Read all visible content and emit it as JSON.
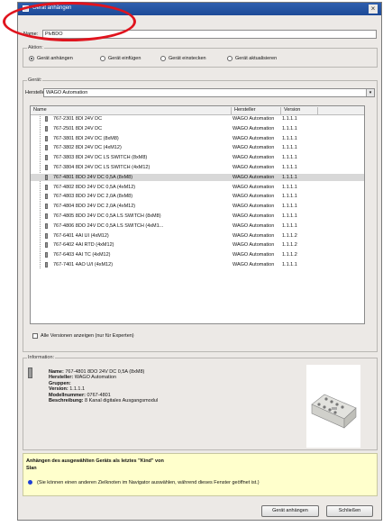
{
  "dialog": {
    "title": "Gerät anhängen",
    "close_glyph": "×"
  },
  "name": {
    "label": "Name:",
    "value": "PlvBDO"
  },
  "aktion": {
    "group_title": "Aktion:",
    "options": [
      {
        "label": "Gerät anhängen",
        "selected": true
      },
      {
        "label": "Gerät einfügen",
        "selected": false
      },
      {
        "label": "Gerät einstecken",
        "selected": false
      },
      {
        "label": "Gerät aktualisieren",
        "selected": false
      }
    ]
  },
  "geraet": {
    "group_title": "Gerät:",
    "hersteller_label": "Hersteller:",
    "hersteller_value": "WAGO Automation",
    "dropdown_glyph": "▾",
    "columns": {
      "name": "Name",
      "hersteller": "Hersteller",
      "version": "Version"
    },
    "rows": [
      {
        "name": "767-2301 8DI 24V DC",
        "hersteller": "WAGO Automation",
        "version": "1.1.1.1",
        "selected": false
      },
      {
        "name": "767-2501 8DI 24V DC",
        "hersteller": "WAGO Automation",
        "version": "1.1.1.1",
        "selected": false
      },
      {
        "name": "767-3801 8DI 24V DC (8xM8)",
        "hersteller": "WAGO Automation",
        "version": "1.1.1.1",
        "selected": false
      },
      {
        "name": "767-3802 8DI 24V DC (4xM12)",
        "hersteller": "WAGO Automation",
        "version": "1.1.1.1",
        "selected": false
      },
      {
        "name": "767-3803 8DI 24V DC LS SWITCH (8xM8)",
        "hersteller": "WAGO Automation",
        "version": "1.1.1.1",
        "selected": false
      },
      {
        "name": "767-3804 8DI 24V DC LS SWITCH (4xM12)",
        "hersteller": "WAGO Automation",
        "version": "1.1.1.1",
        "selected": false
      },
      {
        "name": "767-4801 8DO 24V DC 0,5A (8xM8)",
        "hersteller": "WAGO Automation",
        "version": "1.1.1.1",
        "selected": true
      },
      {
        "name": "767-4802 8DO 24V DC 0,5A (4xM12)",
        "hersteller": "WAGO Automation",
        "version": "1.1.1.1",
        "selected": false
      },
      {
        "name": "767-4803 8DO 24V DC 2,0A (8xM8)",
        "hersteller": "WAGO Automation",
        "version": "1.1.1.1",
        "selected": false
      },
      {
        "name": "767-4804 8DO 24V DC 2,0A (4xM12)",
        "hersteller": "WAGO Automation",
        "version": "1.1.1.1",
        "selected": false
      },
      {
        "name": "767-4805 8DO 24V DC 0,5A LS SWITCH (8xM8)",
        "hersteller": "WAGO Automation",
        "version": "1.1.1.1",
        "selected": false
      },
      {
        "name": "767-4806 8DO 24V DC 0,5A LS SWITCH (4xM1...",
        "hersteller": "WAGO Automation",
        "version": "1.1.1.1",
        "selected": false
      },
      {
        "name": "767-6401 4AI UI (4xM12)",
        "hersteller": "WAGO Automation",
        "version": "1.1.1.2",
        "selected": false
      },
      {
        "name": "767-6402 4AI RTD (4xM12)",
        "hersteller": "WAGO Automation",
        "version": "1.1.1.2",
        "selected": false
      },
      {
        "name": "767-6403 4AI TC (4xM12)",
        "hersteller": "WAGO Automation",
        "version": "1.1.1.2",
        "selected": false
      },
      {
        "name": "767-7401 4AO U/I (4xM12)",
        "hersteller": "WAGO Automation",
        "version": "1.1.1.1",
        "selected": false
      }
    ],
    "all_versions_label": "Alle Versionen anzeigen (nur für Experten)"
  },
  "information": {
    "group_title": "Information:",
    "lines": [
      {
        "key": "Name:",
        "value": "767-4801 8DO 24V DC 0,5A (8xM8)"
      },
      {
        "key": "Hersteller:",
        "value": "WAGO Automation"
      },
      {
        "key": "Gruppen:",
        "value": ""
      },
      {
        "key": "Version:",
        "value": "1.1.1.1"
      },
      {
        "key": "Modellnummer:",
        "value": "0767-4801"
      },
      {
        "key": "Beschreibung:",
        "value": "8 Kanal digitales Ausgangsmodul"
      }
    ]
  },
  "hint": {
    "bold_text": "Anhängen des ausgewählten Geräts als letztes \"Kind\" von",
    "parent_name": "Slan",
    "info_text": "(Sie können einen anderen Zielknoten im Navigator auswählen, während dieses Fenster geöffnet ist.)"
  },
  "buttons": {
    "attach": "Gerät anhängen",
    "close": "Schließen"
  },
  "colors": {
    "title_bar": "#2f5fae",
    "selected_row": "#d8d8d8",
    "hint_bg": "#ffffcc",
    "annotation": "#e0141e",
    "info_icon": "#1e3fd6"
  }
}
